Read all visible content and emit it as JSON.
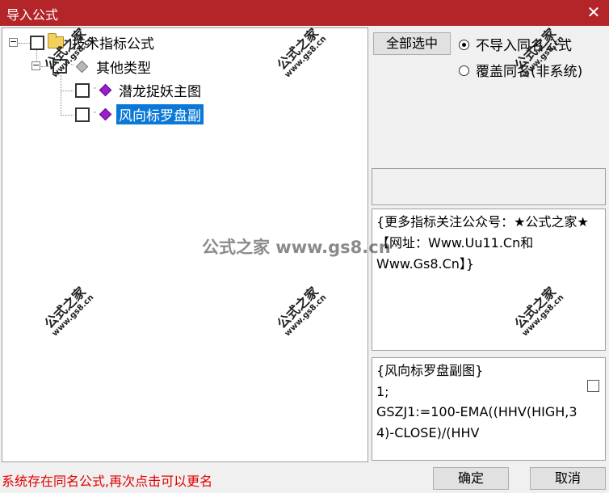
{
  "window": {
    "title": "导入公式",
    "close_glyph": "✕"
  },
  "tree": {
    "root": {
      "label": "技术指标公式",
      "expander": "−"
    },
    "group": {
      "label": "其他类型",
      "expander": "−"
    },
    "items": [
      {
        "label": "潜龙捉妖主图",
        "selected": false
      },
      {
        "label": "风向标罗盘副",
        "selected": true
      }
    ]
  },
  "options": {
    "select_all_label": "全部选中",
    "radio_options": [
      {
        "label": "不导入同名公式",
        "checked": true
      },
      {
        "label": "覆盖同名(非系统)",
        "checked": false
      }
    ]
  },
  "description_text": "{更多指标关注公众号：★公式之家★ 【网址：Www.Uu11.Cn和Www.Gs8.Cn】}",
  "code_preview": "{风向标罗盘副图}\n1;\nGSZJ1:=100-EMA((HHV(HIGH,34)-CLOSE)/(HHV",
  "status_message": "系统存在同名公式,再次点击可以更名",
  "buttons": {
    "ok": "确定",
    "cancel": "取消"
  },
  "watermark": {
    "cn": "公式之家",
    "url": "www.gs8.cn",
    "center": "公式之家 www.gs8.cn"
  }
}
